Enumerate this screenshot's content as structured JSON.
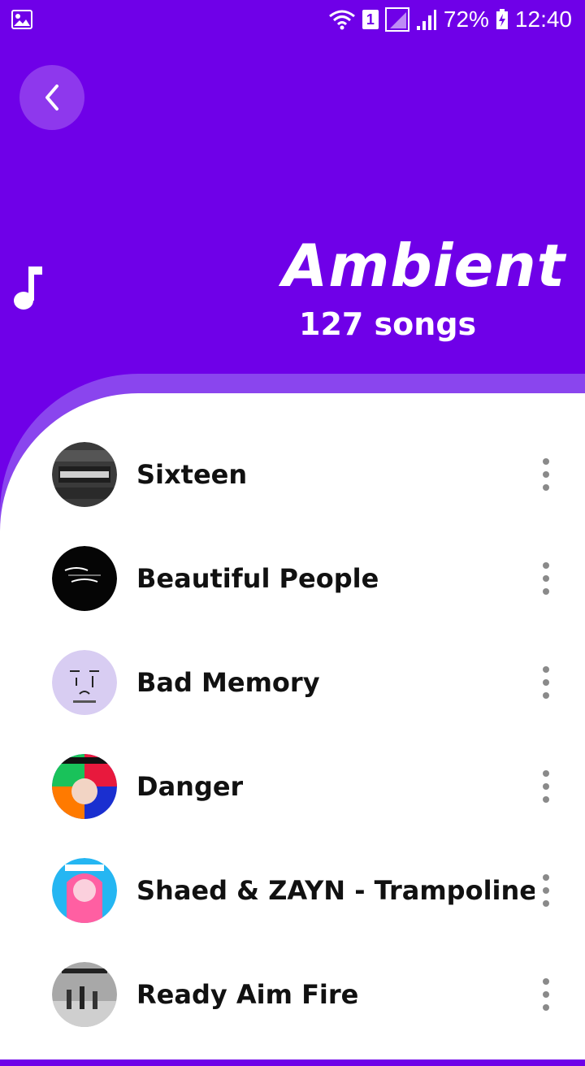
{
  "status_bar": {
    "battery": "72%",
    "time": "12:40",
    "sim_slot": "1",
    "icons": [
      "gallery-icon",
      "wifi-icon",
      "sim-badge",
      "signal-icon",
      "signal-icon-2",
      "battery-charging-icon"
    ]
  },
  "header": {
    "back_icon": "chevron-left-icon",
    "title": "Ambient",
    "song_count": "127 songs",
    "note_icon": "music-note-icon"
  },
  "songs": [
    {
      "title": "Sixteen",
      "art": "sixteen-cover",
      "menu_icon": "more-vertical-icon"
    },
    {
      "title": "Beautiful People",
      "art": "beautiful-people-cover",
      "menu_icon": "more-vertical-icon"
    },
    {
      "title": "Bad Memory",
      "art": "bad-memory-cover",
      "menu_icon": "more-vertical-icon"
    },
    {
      "title": "Danger",
      "art": "danger-cover",
      "menu_icon": "more-vertical-icon"
    },
    {
      "title": "Shaed & ZAYN - Trampoline",
      "art": "trampoline-cover",
      "menu_icon": "more-vertical-icon"
    },
    {
      "title": "Ready Aim Fire",
      "art": "ready-aim-fire-cover",
      "menu_icon": "more-vertical-icon"
    }
  ],
  "colors": {
    "header_bg": "#6f00e8",
    "accent_band": "#8a45ee",
    "list_bg": "#ffffff",
    "text_dark": "#111111",
    "menu_dots": "#8a8a8a"
  }
}
